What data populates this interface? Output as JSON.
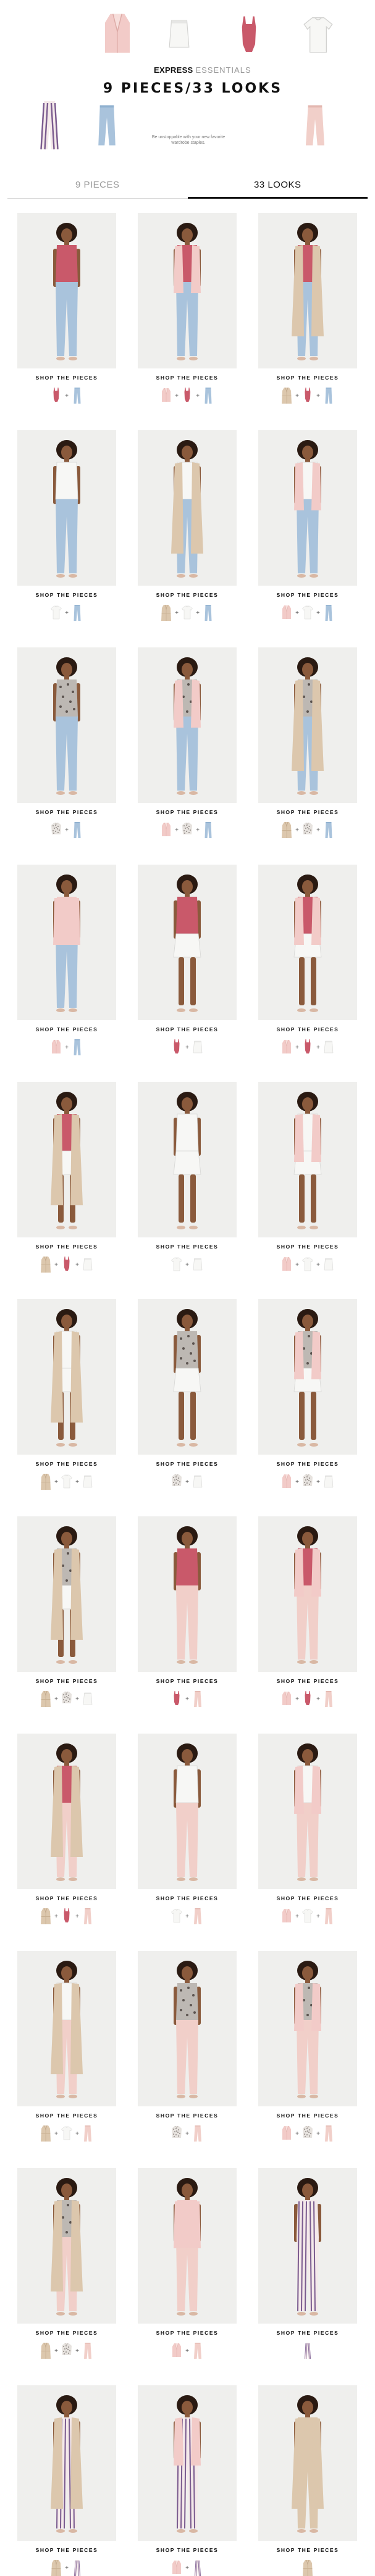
{
  "header": {
    "brand_bold": "EXPRESS",
    "brand_light": "ESSENTIALS",
    "title": "9 PIECES/33 LOOKS",
    "tagline": "Be unstoppable with your new favorite wardrobe staples."
  },
  "hero_items": [
    "trench-coat",
    "blazer",
    "white-skirt",
    "bodysuit",
    "white-tee",
    "striped-jumpsuit",
    "jeans",
    "leopard-blouse",
    "pink-pants"
  ],
  "tabs": [
    {
      "label": "9 PIECES",
      "active": false
    },
    {
      "label": "33 LOOKS",
      "active": true
    }
  ],
  "shop_label": "SHOP THE PIECES",
  "colors": {
    "photo_bg": "#efefed",
    "trench": "#dcc7ad",
    "blazer": "#f2cbc8",
    "bodysuit": "#c9596a",
    "denim": "#a9c3dc",
    "white": "#f7f7f5",
    "leopard": "#bdb8b3",
    "pink_pants": "#f1cfc9",
    "stripe_a": "#7a5b8f",
    "stripe_b": "#f4e9ea",
    "skin": "#8a5a3c",
    "hair": "#2a1a12"
  },
  "looks": [
    {
      "top": "bodysuit",
      "bottom": "jeans",
      "layer": "",
      "pieces": [
        "bodysuit",
        "jeans"
      ]
    },
    {
      "top": "bodysuit",
      "bottom": "jeans",
      "layer": "blazer",
      "pieces": [
        "blazer",
        "bodysuit",
        "jeans"
      ]
    },
    {
      "top": "bodysuit",
      "bottom": "jeans",
      "layer": "trench",
      "pieces": [
        "trench",
        "bodysuit",
        "jeans"
      ]
    },
    {
      "top": "white-tee",
      "bottom": "jeans",
      "layer": "",
      "pieces": [
        "white-tee",
        "jeans"
      ]
    },
    {
      "top": "white-tee",
      "bottom": "jeans",
      "layer": "trench",
      "pieces": [
        "trench",
        "white-tee",
        "jeans"
      ]
    },
    {
      "top": "white-tee",
      "bottom": "jeans",
      "layer": "blazer",
      "pieces": [
        "blazer",
        "white-tee",
        "jeans"
      ]
    },
    {
      "top": "leopard",
      "bottom": "jeans",
      "layer": "",
      "pieces": [
        "leopard",
        "jeans"
      ]
    },
    {
      "top": "leopard",
      "bottom": "jeans",
      "layer": "blazer",
      "pieces": [
        "blazer",
        "leopard",
        "jeans"
      ]
    },
    {
      "top": "leopard",
      "bottom": "jeans",
      "layer": "trench",
      "pieces": [
        "trench",
        "leopard",
        "jeans"
      ]
    },
    {
      "top": "blazer",
      "bottom": "jeans",
      "layer": "",
      "pieces": [
        "blazer",
        "jeans"
      ]
    },
    {
      "top": "bodysuit",
      "bottom": "white-skirt",
      "layer": "",
      "pieces": [
        "bodysuit",
        "white-skirt"
      ]
    },
    {
      "top": "bodysuit",
      "bottom": "white-skirt",
      "layer": "blazer",
      "pieces": [
        "blazer",
        "bodysuit",
        "white-skirt"
      ]
    },
    {
      "top": "bodysuit",
      "bottom": "white-skirt",
      "layer": "trench",
      "pieces": [
        "trench",
        "bodysuit",
        "white-skirt"
      ]
    },
    {
      "top": "white-tee",
      "bottom": "white-skirt",
      "layer": "",
      "pieces": [
        "white-tee",
        "white-skirt"
      ]
    },
    {
      "top": "white-tee",
      "bottom": "white-skirt",
      "layer": "blazer",
      "pieces": [
        "blazer",
        "white-tee",
        "white-skirt"
      ]
    },
    {
      "top": "white-tee",
      "bottom": "white-skirt",
      "layer": "trench",
      "pieces": [
        "trench",
        "white-tee",
        "white-skirt"
      ]
    },
    {
      "top": "leopard",
      "bottom": "white-skirt",
      "layer": "",
      "pieces": [
        "leopard",
        "white-skirt"
      ]
    },
    {
      "top": "leopard",
      "bottom": "white-skirt",
      "layer": "blazer",
      "pieces": [
        "blazer",
        "leopard",
        "white-skirt"
      ]
    },
    {
      "top": "leopard",
      "bottom": "white-skirt",
      "layer": "trench",
      "pieces": [
        "trench",
        "leopard",
        "white-skirt"
      ]
    },
    {
      "top": "bodysuit",
      "bottom": "pink-pants",
      "layer": "",
      "pieces": [
        "bodysuit",
        "pink-pants"
      ]
    },
    {
      "top": "bodysuit",
      "bottom": "pink-pants",
      "layer": "blazer",
      "pieces": [
        "blazer",
        "bodysuit",
        "pink-pants"
      ]
    },
    {
      "top": "bodysuit",
      "bottom": "pink-pants",
      "layer": "trench",
      "pieces": [
        "trench",
        "bodysuit",
        "pink-pants"
      ]
    },
    {
      "top": "white-tee",
      "bottom": "pink-pants",
      "layer": "",
      "pieces": [
        "white-tee",
        "pink-pants"
      ]
    },
    {
      "top": "white-tee",
      "bottom": "pink-pants",
      "layer": "blazer",
      "pieces": [
        "blazer",
        "white-tee",
        "pink-pants"
      ]
    },
    {
      "top": "white-tee",
      "bottom": "pink-pants",
      "layer": "trench",
      "pieces": [
        "trench",
        "white-tee",
        "pink-pants"
      ]
    },
    {
      "top": "leopard",
      "bottom": "pink-pants",
      "layer": "",
      "pieces": [
        "leopard",
        "pink-pants"
      ]
    },
    {
      "top": "leopard",
      "bottom": "pink-pants",
      "layer": "blazer",
      "pieces": [
        "blazer",
        "leopard",
        "pink-pants"
      ]
    },
    {
      "top": "leopard",
      "bottom": "pink-pants",
      "layer": "trench",
      "pieces": [
        "trench",
        "leopard",
        "pink-pants"
      ]
    },
    {
      "top": "blazer",
      "bottom": "pink-pants",
      "layer": "",
      "pieces": [
        "blazer",
        "pink-pants"
      ]
    },
    {
      "top": "striped-jumpsuit",
      "bottom": "striped-jumpsuit",
      "layer": "",
      "pieces": [
        "striped-jumpsuit"
      ]
    },
    {
      "top": "striped-jumpsuit",
      "bottom": "striped-jumpsuit",
      "layer": "trench",
      "pieces": [
        "trench",
        "striped-jumpsuit"
      ]
    },
    {
      "top": "striped-jumpsuit",
      "bottom": "striped-jumpsuit",
      "layer": "blazer",
      "pieces": [
        "blazer",
        "striped-jumpsuit"
      ]
    },
    {
      "top": "trench",
      "bottom": "trench",
      "layer": "",
      "pieces": [
        "trench"
      ]
    }
  ]
}
